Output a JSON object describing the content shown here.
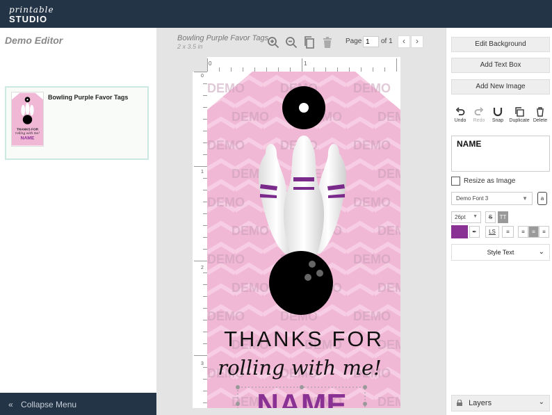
{
  "app": {
    "logo_line1": "printable",
    "logo_line2": "STUDIO"
  },
  "sidebar": {
    "title": "Demo Editor",
    "design_name": "Bowling Purple Favor Tags",
    "collapse_label": "Collapse Menu"
  },
  "workspace": {
    "doc_title": "Bowling Purple Favor Tags",
    "doc_size": "2 x 3.5 in",
    "page_label": "Page",
    "page_value": "1",
    "page_of": "of 1",
    "ruler_x_labels": [
      "0",
      "1"
    ],
    "ruler_y_labels": [
      "0",
      "1",
      "2",
      "3"
    ]
  },
  "tag": {
    "watermark": "DEMO",
    "line1": "THANKS FOR",
    "line2": "rolling with me!",
    "name": "NAME",
    "bg_color": "#f1b8d6",
    "accent_color": "#8a3194",
    "ball_color": "#000000"
  },
  "panel": {
    "edit_background": "Edit Background",
    "add_text_box": "Add Text Box",
    "add_new_image": "Add New Image",
    "actions": [
      {
        "label": "Undo",
        "icon": "undo-icon"
      },
      {
        "label": "Redo",
        "icon": "redo-icon"
      },
      {
        "label": "Snap",
        "icon": "magnet-icon"
      },
      {
        "label": "Duplicate",
        "icon": "duplicate-icon"
      },
      {
        "label": "Delete",
        "icon": "trash-icon"
      }
    ],
    "text_value": "NAME",
    "resize_label": "Resize as Image",
    "font_name": "Demo Font 3",
    "font_btn_label": "a",
    "font_size": "26pt",
    "strike_label": "S",
    "caps_label": "TT",
    "ls_label": "LS",
    "text_color": "#8a3194",
    "style_text_label": "Style Text",
    "layers_label": "Layers"
  }
}
